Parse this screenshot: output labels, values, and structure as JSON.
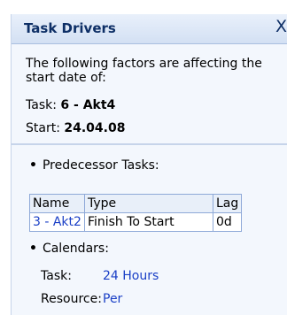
{
  "panel": {
    "title": "Task Drivers",
    "close_glyph": "X",
    "intro": "The following factors are affecting the start date of:",
    "task_label": "Task:",
    "task_value": "6 - Akt4",
    "start_label": "Start:",
    "start_value": "24.04.08"
  },
  "predecessors": {
    "heading": "Predecessor Tasks:",
    "columns": [
      "Name",
      "Type",
      "Lag"
    ],
    "rows": [
      {
        "name": "3 - Akt2",
        "type": "Finish To Start",
        "lag": "0d"
      }
    ]
  },
  "calendars": {
    "heading": "Calendars:",
    "task_label": "Task:",
    "task_value": "24 Hours",
    "resource_label": "Resource:",
    "resource_value": "Per"
  },
  "colors": {
    "title": "#0e2f66",
    "link": "#1a3fc6",
    "panel_bg": "#f3f7fd",
    "table_border": "#8ea9d8"
  }
}
